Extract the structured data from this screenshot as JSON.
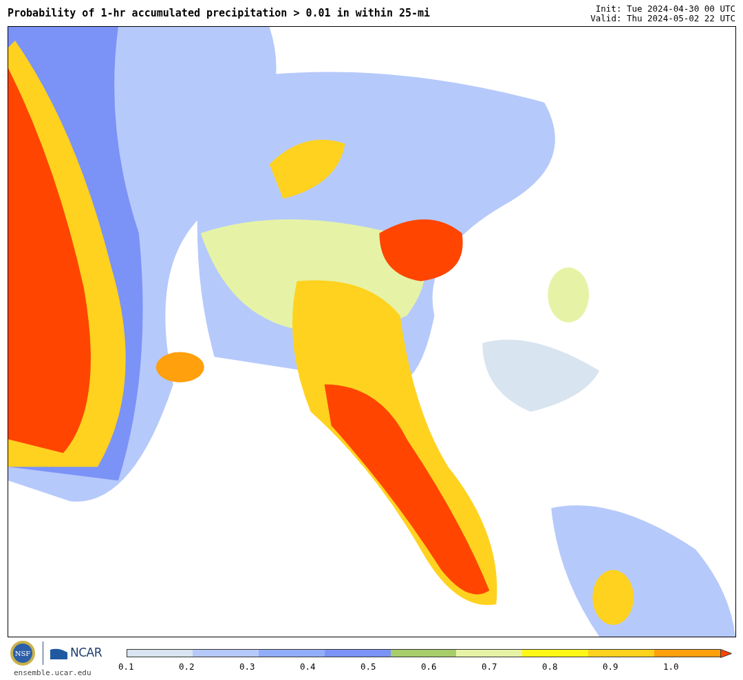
{
  "title": "Probability of 1-hr accumulated precipitation > 0.01 in within 25-mi",
  "init": "Init: Tue 2024-04-30 00 UTC",
  "valid": "Valid: Thu 2024-05-02 22 UTC",
  "logos": {
    "seal_text": "NSF",
    "wordmark": "NCAR",
    "site": "ensemble.ucar.edu"
  },
  "colorbar": {
    "segments": [
      {
        "color": "#d8e4ef"
      },
      {
        "color": "#b6c9fb"
      },
      {
        "color": "#93aef8"
      },
      {
        "color": "#7b92f7"
      },
      {
        "color": "#a7cc6a"
      },
      {
        "color": "#e6f3a6"
      },
      {
        "color": "#fff715"
      },
      {
        "color": "#ffd21f"
      },
      {
        "color": "#ffa00c"
      }
    ],
    "extend": {
      "color": "#ff4500"
    },
    "ticks": [
      "0.1",
      "0.2",
      "0.3",
      "0.4",
      "0.5",
      "0.6",
      "0.7",
      "0.8",
      "0.9",
      "1.0"
    ]
  }
}
